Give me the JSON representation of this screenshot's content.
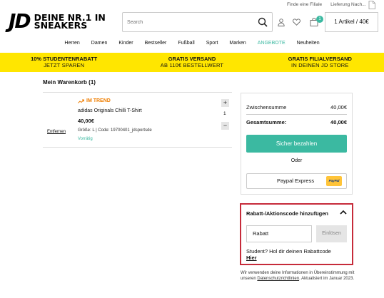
{
  "header": {
    "logo_jd": "JD",
    "logo_line1": "DEINE NR.1 IN",
    "logo_line2": "SNEAKERS",
    "search_placeholder": "Search",
    "top_links": [
      "Finde eine Filiale",
      "Lieferung Nach..."
    ],
    "cart_badge": "1",
    "cart_label": "1 Artikel / 40€"
  },
  "nav": {
    "items": [
      "Herren",
      "Damen",
      "Kinder",
      "Bestseller",
      "Fußball",
      "Sport",
      "Marken",
      "ANGEBOTE",
      "Neuheiten"
    ]
  },
  "promo": [
    {
      "line1": "10% STUDENTENRABATT",
      "line2": "JETZT SPAREN"
    },
    {
      "line1": "GRATIS VERSAND",
      "line2": "AB 110€ BESTELLWERT"
    },
    {
      "line1": "GRATIS FILIALVERSAND",
      "line2": "IN DEINEN JD STORE"
    }
  ],
  "cart": {
    "title": "Mein Warenkorb (1)",
    "item": {
      "badge": "IM TREND",
      "name": "adidas Originals Chilli T-Shirt",
      "price": "40,00€",
      "meta": "Größe: L | Code: 19700401_jdsportsde",
      "stock": "Vorrätig",
      "remove": "Entfernen",
      "qty": "1",
      "plus": "+",
      "minus": "−"
    }
  },
  "summary": {
    "subtotal_label": "Zwischensumme",
    "subtotal_value": "40,00€",
    "total_label": "Gesamtsumme:",
    "total_value": "40,00€",
    "pay_button": "Sicher bezahlen",
    "or": "Oder",
    "paypal_label": "Paypal Express",
    "paypal_logo": "PayPal"
  },
  "discount": {
    "title": "Rabatt-/Aktionscode hinzufügen",
    "input_value": "Rabatt",
    "apply_button": "Einlösen",
    "student_text": "Student? Hol dir deinen Rabattcode",
    "student_link": "Hier"
  },
  "info": {
    "text1": "Wir verwenden deine Informationen in Übereinstimmung mit unseren",
    "link": "Datenschutzrichtlinien",
    "text2": ". Aktualisiert im Januar 2023."
  },
  "colors": {
    "accent": "#3bb9a1",
    "promo_yellow": "#ffe600",
    "trend_orange": "#ef7d00",
    "highlight_red": "#c62b3a"
  }
}
